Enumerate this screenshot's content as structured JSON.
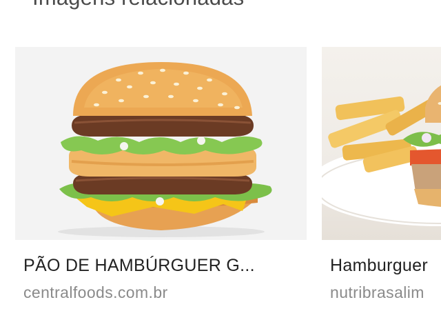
{
  "section": {
    "title": "Imagens relacionadas"
  },
  "results": [
    {
      "title": "PÃO DE HAMBÚRGUER G...",
      "source": "centralfoods.com.br",
      "image_icon": "burger-image"
    },
    {
      "title": "Hamburguer",
      "source": "nutribrasalim",
      "image_icon": "burger-with-fries-image"
    }
  ],
  "colors": {
    "title_text": "#4a4a4a",
    "card_title": "#222222",
    "source_text": "#8a8a8a",
    "thumb_bg": "#f3f3f3"
  }
}
